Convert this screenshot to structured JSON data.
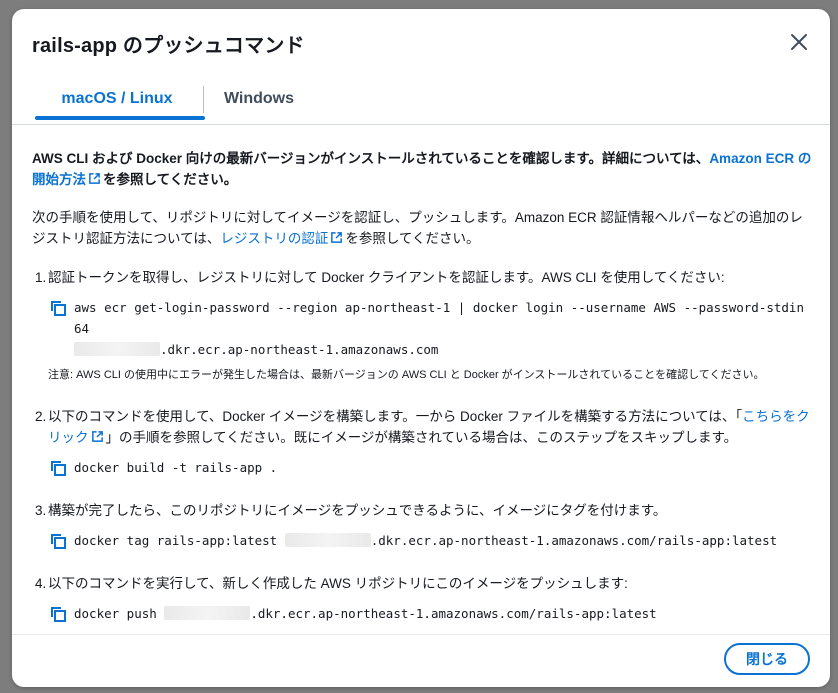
{
  "modal": {
    "title": "rails-app のプッシュコマンド",
    "tabs": [
      {
        "label": "macOS / Linux",
        "active": true
      },
      {
        "label": "Windows",
        "active": false
      }
    ],
    "intro": {
      "text": "AWS CLI および Docker 向けの最新バージョンがインストールされていることを確認します。詳細については、",
      "link": "Amazon ECR の開始方法",
      "suffix": "を参照してください。"
    },
    "para2": {
      "text": "次の手順を使用して、リポジトリに対してイメージを認証し、プッシュします。Amazon ECR 認証情報ヘルパーなどの追加のレジストリ認証方法については、",
      "link": "レジストリの認証",
      "suffix": "を参照してください。"
    },
    "steps": [
      {
        "num": "1.",
        "text": "認証トークンを取得し、レジストリに対して Docker クライアントを認証します。AWS CLI を使用してください:",
        "cmd_line1": "aws ecr get-login-password --region ap-northeast-1 | docker login --username AWS --password-stdin 64",
        "cmd_line2": ".dkr.ecr.ap-northeast-1.amazonaws.com",
        "note": "注意: AWS CLI の使用中にエラーが発生した場合は、最新バージョンの AWS CLI と Docker がインストールされていることを確認してください。"
      },
      {
        "num": "2.",
        "text": "以下のコマンドを使用して、Docker イメージを構築します。一から Docker ファイルを構築する方法については、「",
        "link": "こちらをクリック",
        "suffix": "」の手順を参照してください。既にイメージが構築されている場合は、このステップをスキップします。",
        "cmd": "docker build -t rails-app ."
      },
      {
        "num": "3.",
        "text": "構築が完了したら、このリポジトリにイメージをプッシュできるように、イメージにタグを付けます。",
        "cmd_prefix": "docker tag rails-app:latest",
        "cmd_suffix": ".dkr.ecr.ap-northeast-1.amazonaws.com/rails-app:latest"
      },
      {
        "num": "4.",
        "text": "以下のコマンドを実行して、新しく作成した AWS リポジトリにこのイメージをプッシュします:",
        "cmd_prefix": "docker push",
        "cmd_suffix": ".dkr.ecr.ap-northeast-1.amazonaws.com/rails-app:latest"
      }
    ],
    "close_button": "閉じる",
    "icons": {
      "close": "close-icon",
      "copy": "copy-icon",
      "external": "external-link-icon"
    },
    "colors": {
      "accent": "#0972d3",
      "text": "#16191f",
      "overlay": "#7d7d7d"
    }
  }
}
